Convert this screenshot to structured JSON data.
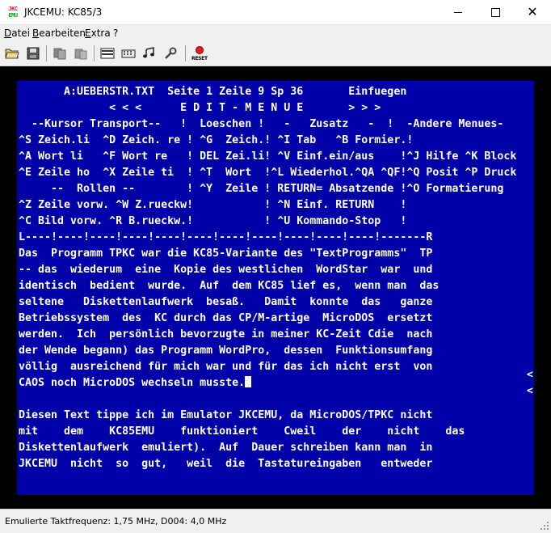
{
  "window": {
    "title": "JKCEMU: KC85/3",
    "icon_text_top": "JKC",
    "icon_text_bottom": "EMU"
  },
  "menu": {
    "items": [
      "Datei",
      "Bearbeiten",
      "Extra",
      "?"
    ]
  },
  "toolbar": {
    "icons": [
      "open-folder-icon",
      "save-icon",
      "copy-icon",
      "paste-icon",
      "memory-editor-icon",
      "keyboard-icon",
      "audio-icon",
      "settings-icon",
      "reset-icon"
    ],
    "reset_label": "RESET"
  },
  "screen": {
    "lines": [
      "       A:UEBERSTR.TXT  Seite 1 Zeile 9 Sp 36       Einfuegen",
      "              < < <      E D I T - M E N U E       > > >",
      "  --Kursor Transport--   !  Loeschen !   -   Zusatz   -  !  -Andere Menues-",
      "^S Zeich.li  ^D Zeich. re ! ^G  Zeich.! ^I Tab   ^B Formier.!",
      "^A Wort li   ^F Wort re   ! DEL Zei.li! ^V Einf.ein/aus    !^J Hilfe ^K Block",
      "^E Zeile ho  ^X Zeile ti  ! ^T  Wort  !^L Wiederhol.^QA ^QF!^Q Posit ^P Druck",
      "     --  Rollen --        ! ^Y  Zeile ! RETURN= Absatzende !^O Formatierung",
      "^Z Zeile vorw. ^W Z.rueckw!           ! ^N Einf. RETURN    !",
      "^C Bild vorw. ^R B.rueckw.!           ! ^U Kommando-Stop   !",
      "L----!----!----!----!----!----!----!----!----!----!----!-------R",
      "Das  Programm TPKC war die KC85-Variante des \"TextProgramms\"  TP",
      "-- das  wiederum  eine  Kopie des westlichen  WordStar  war  und",
      "identisch  bedient  wurde.  Auf  dem KC85 lief es,  wenn man  das",
      "seltene   Diskettenlaufwerk  besaß.   Damit  konnte  das   ganze",
      "Betriebssystem  des  KC durch das CP/M-artige  MicroDOS  ersetzt",
      "werden.  Ich  persönlich bevorzugte in meiner KC-Zeit Cdie  nach",
      "der Wende begann) das Programm WordPro,  dessen  Funktionsumfang",
      "völlig  ausreichend für mich war und für das ich nicht erst  von",
      "CAOS noch MicroDOS wechseln musste.",
      "",
      "Diesen Text tippe ich im Emulator JKCEMU, da MicroDOS/TPKC nicht",
      "mit    dem    KC85EMU    funktioniert    Cweil    der    nicht    das",
      "Diskettenlaufwerk  emuliert).  Auf  Dauer schreiben kann man  in",
      "JKCEMU  nicht  so  gut,   weil  die  Tastatureingaben   entweder"
    ],
    "right_marks": [
      "<",
      "<"
    ]
  },
  "status": {
    "text": "Emulierte Taktfrequenz: 1,75 MHz, D004: 4,0 MHz"
  },
  "colors": {
    "screen_bg": "#0000a8",
    "screen_fg": "#ffffff",
    "frame": "#000000"
  }
}
